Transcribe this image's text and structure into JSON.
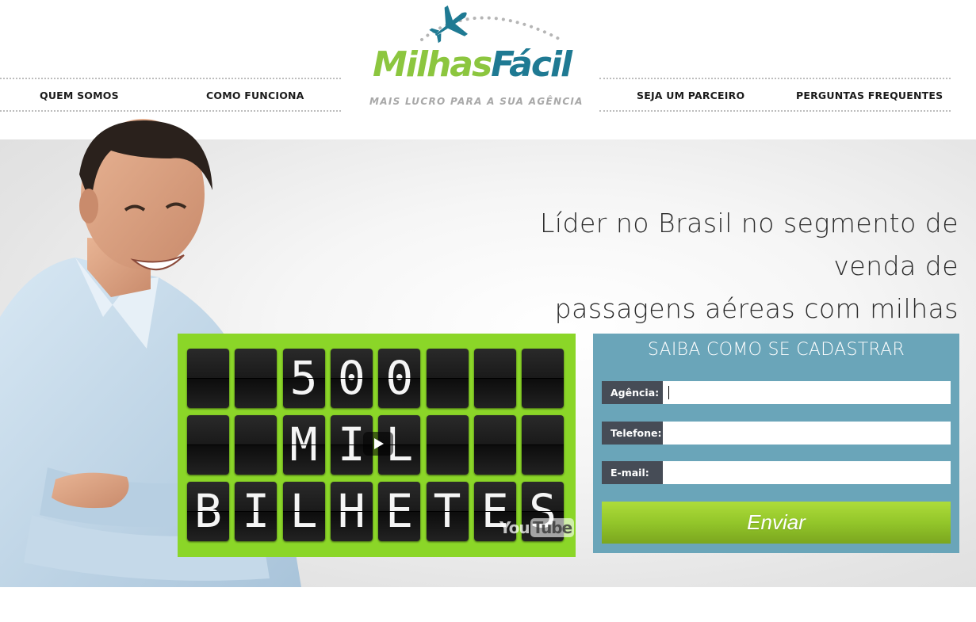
{
  "nav": {
    "left": [
      {
        "label": "QUEM SOMOS"
      },
      {
        "label": "COMO FUNCIONA"
      }
    ],
    "right": [
      {
        "label": "SEJA UM PARCEIRO"
      },
      {
        "label": "PERGUNTAS FREQUENTES"
      }
    ]
  },
  "logo": {
    "word_part1": "Milhas",
    "word_part2": "Fácil",
    "tagline": "MAIS LUCRO PARA A SUA AGÊNCIA",
    "color_green": "#8cc63f",
    "color_blue": "#1f7a93",
    "icon": "airplane-icon"
  },
  "hero": {
    "headline_line1": "Líder no Brasil no segmento de venda de",
    "headline_line2": "passagens aéreas com milhas"
  },
  "video": {
    "board_rows": [
      "500",
      "MIL",
      "BILHETES"
    ],
    "provider": "YouTube",
    "provider_a": "You",
    "provider_b": "Tube",
    "background_color": "#8bd628",
    "icon": "play-icon"
  },
  "form": {
    "title": "SAIBA COMO SE CADASTRAR",
    "fields": [
      {
        "label": "Agência:",
        "value": ""
      },
      {
        "label": "Telefone:",
        "value": ""
      },
      {
        "label": "E-mail:",
        "value": ""
      }
    ],
    "submit_label": "Enviar",
    "panel_color": "#6aa5b9",
    "button_color": "#93c62a"
  }
}
